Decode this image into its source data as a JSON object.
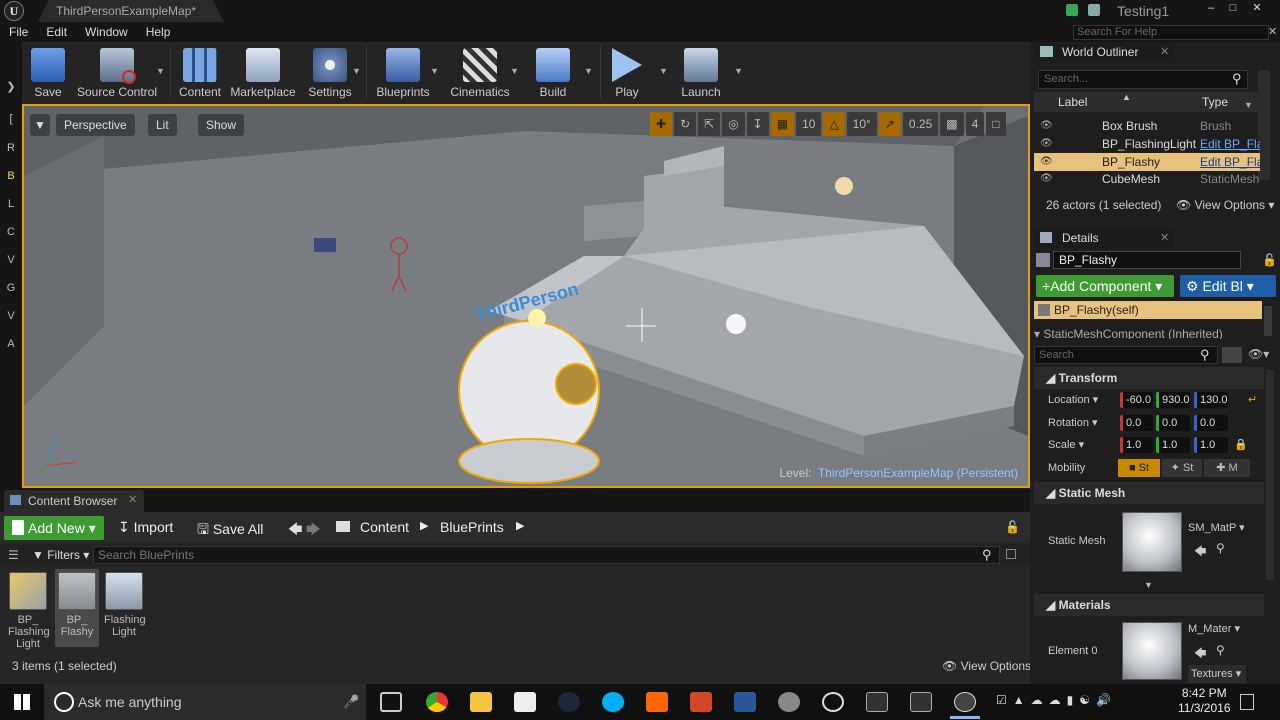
{
  "title_bar": {
    "doc_tab": "ThirdPersonExampleMap*",
    "project": "Testing1"
  },
  "menu": [
    "File",
    "Edit",
    "Window",
    "Help"
  ],
  "help_search": {
    "placeholder": "Search For Help"
  },
  "left_strip": [
    "R",
    "B",
    "L",
    "C",
    "V",
    "G",
    "V",
    "A"
  ],
  "toolbar": [
    {
      "label": "Save",
      "icon": "save-icon"
    },
    {
      "label": "Source Control",
      "icon": "source-control-icon"
    },
    {
      "label": "Content",
      "icon": "content-icon"
    },
    {
      "label": "Marketplace",
      "icon": "marketplace-icon"
    },
    {
      "label": "Settings",
      "icon": "settings-icon"
    },
    {
      "label": "Blueprints",
      "icon": "blueprints-icon"
    },
    {
      "label": "Cinematics",
      "icon": "cinematics-icon"
    },
    {
      "label": "Build",
      "icon": "build-icon"
    },
    {
      "label": "Play",
      "icon": "play-icon"
    },
    {
      "label": "Launch",
      "icon": "launch-icon"
    }
  ],
  "viewport": {
    "perspective": "Perspective",
    "lit": "Lit",
    "show": "Show",
    "snap": {
      "grid": "10",
      "rotation": "10°",
      "scale": "0.25",
      "camera_speed": "4"
    },
    "level_prefix": "Level:",
    "level_name": "ThirdPersonExampleMap (Persistent)",
    "floor_text": "ThirdPerson"
  },
  "content_browser": {
    "tab": "Content Browser",
    "add_new": "Add New",
    "import": "Import",
    "save_all": "Save All",
    "path": [
      "Content",
      "BluePrints"
    ],
    "filters": "Filters",
    "search_placeholder": "Search BluePrints",
    "assets": [
      {
        "name": "BP_ Flashing Light"
      },
      {
        "name": "BP_ Flashy",
        "selected": true
      },
      {
        "name": "Flashing Light"
      }
    ],
    "count": "3 items (1 selected)",
    "view_options": "View Options"
  },
  "world_outliner": {
    "tab": "World Outliner",
    "search_placeholder": "Search...",
    "col_label": "Label",
    "col_type": "Type",
    "rows": [
      {
        "label": "Box Brush",
        "type": "Brush",
        "link": false
      },
      {
        "label": "BP_FlashingLight",
        "type": "Edit BP_Fla",
        "link": true
      },
      {
        "label": "BP_Flashy",
        "type": "Edit BP_Fla",
        "link": true,
        "selected": true
      },
      {
        "label": "CubeMesh",
        "type": "StaticMesh",
        "link": false
      }
    ],
    "status": "26 actors (1 selected)",
    "view_options": "View Options"
  },
  "details": {
    "tab": "Details",
    "name": "BP_Flashy",
    "add_component": "Add Component",
    "edit_bp": "Edit Bl",
    "component_self": "BP_Flashy(self)",
    "component_inherited": "StaticMeshComponent (Inherited)",
    "search_placeholder": "Search",
    "transform": {
      "title": "Transform",
      "location_label": "Location",
      "location": [
        "-60.0",
        "930.0",
        "130.0"
      ],
      "rotation_label": "Rotation",
      "rotation": [
        "0.0",
        "0.0",
        "0.0"
      ],
      "scale_label": "Scale",
      "scale": [
        "1.0",
        "1.0",
        "1.0"
      ],
      "mobility_label": "Mobility",
      "mobility": [
        "St",
        "St",
        "M"
      ]
    },
    "static_mesh": {
      "title": "Static Mesh",
      "label": "Static Mesh",
      "value": "SM_MatP"
    },
    "materials": {
      "title": "Materials",
      "label": "Element 0",
      "value": "M_Mater",
      "textures": "Textures"
    }
  },
  "taskbar": {
    "search": "Ask me anything",
    "time": "8:42 PM",
    "date": "11/3/2016"
  }
}
